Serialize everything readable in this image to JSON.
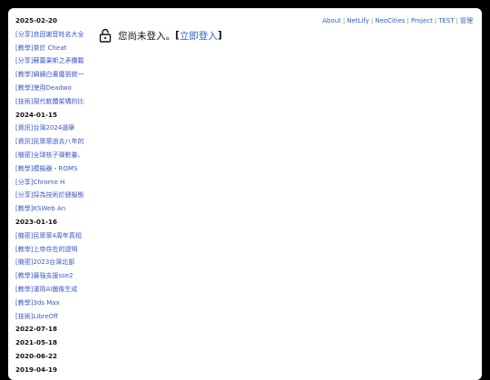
{
  "sidebar": [
    {
      "kind": "date",
      "text": "2025-02-20"
    },
    {
      "kind": "post",
      "text": "[分享]良固謝音姓名大全"
    },
    {
      "kind": "post",
      "text": "[教學]茶於 Cheat"
    },
    {
      "kind": "post",
      "text": "[分享]蘇蕾果斯之矛攤載"
    },
    {
      "kind": "post",
      "text": "[教學]鍋鍋白書魔張統一"
    },
    {
      "kind": "post",
      "text": "[教學]使用Deadwo"
    },
    {
      "kind": "post",
      "text": "[技術]現代軟體架構的比"
    },
    {
      "kind": "date",
      "text": "2024-01-15"
    },
    {
      "kind": "post",
      "text": "[資訊]台灣2024選舉"
    },
    {
      "kind": "post",
      "text": "[資訊]民眾黨過去八年的"
    },
    {
      "kind": "post",
      "text": "[機密]全球核子彈數量、"
    },
    {
      "kind": "post",
      "text": "[教學]模擬器・ROMS"
    },
    {
      "kind": "post",
      "text": "[分享]Chrome H"
    },
    {
      "kind": "post",
      "text": "[分享]採為技術於鏈擬態"
    },
    {
      "kind": "post",
      "text": "[教學]KSWeb An"
    },
    {
      "kind": "date",
      "text": "2023-01-16"
    },
    {
      "kind": "post",
      "text": "[機密]民眾黨4周年真相"
    },
    {
      "kind": "post",
      "text": "[教學]上帝存在的證明"
    },
    {
      "kind": "post",
      "text": "[機密]2023台灣北部"
    },
    {
      "kind": "post",
      "text": "[教學]最強支援sse2"
    },
    {
      "kind": "post",
      "text": "[教學]運用AI圖像生成"
    },
    {
      "kind": "post",
      "text": "[教學]3ds Max"
    },
    {
      "kind": "post",
      "text": "[技術]LibreOff"
    },
    {
      "kind": "date",
      "text": "2022-07-18"
    },
    {
      "kind": "date",
      "text": "2021-05-18"
    },
    {
      "kind": "date",
      "text": "2020-06-22"
    },
    {
      "kind": "date",
      "text": "2019-04-19"
    }
  ],
  "nav": [
    "About",
    "NetLify",
    "NeoCities",
    "Project",
    "TEST",
    "管理"
  ],
  "login": {
    "status": "您尚未登入。",
    "open_bracket": "[",
    "link": "立即登入",
    "close_bracket": "]"
  }
}
